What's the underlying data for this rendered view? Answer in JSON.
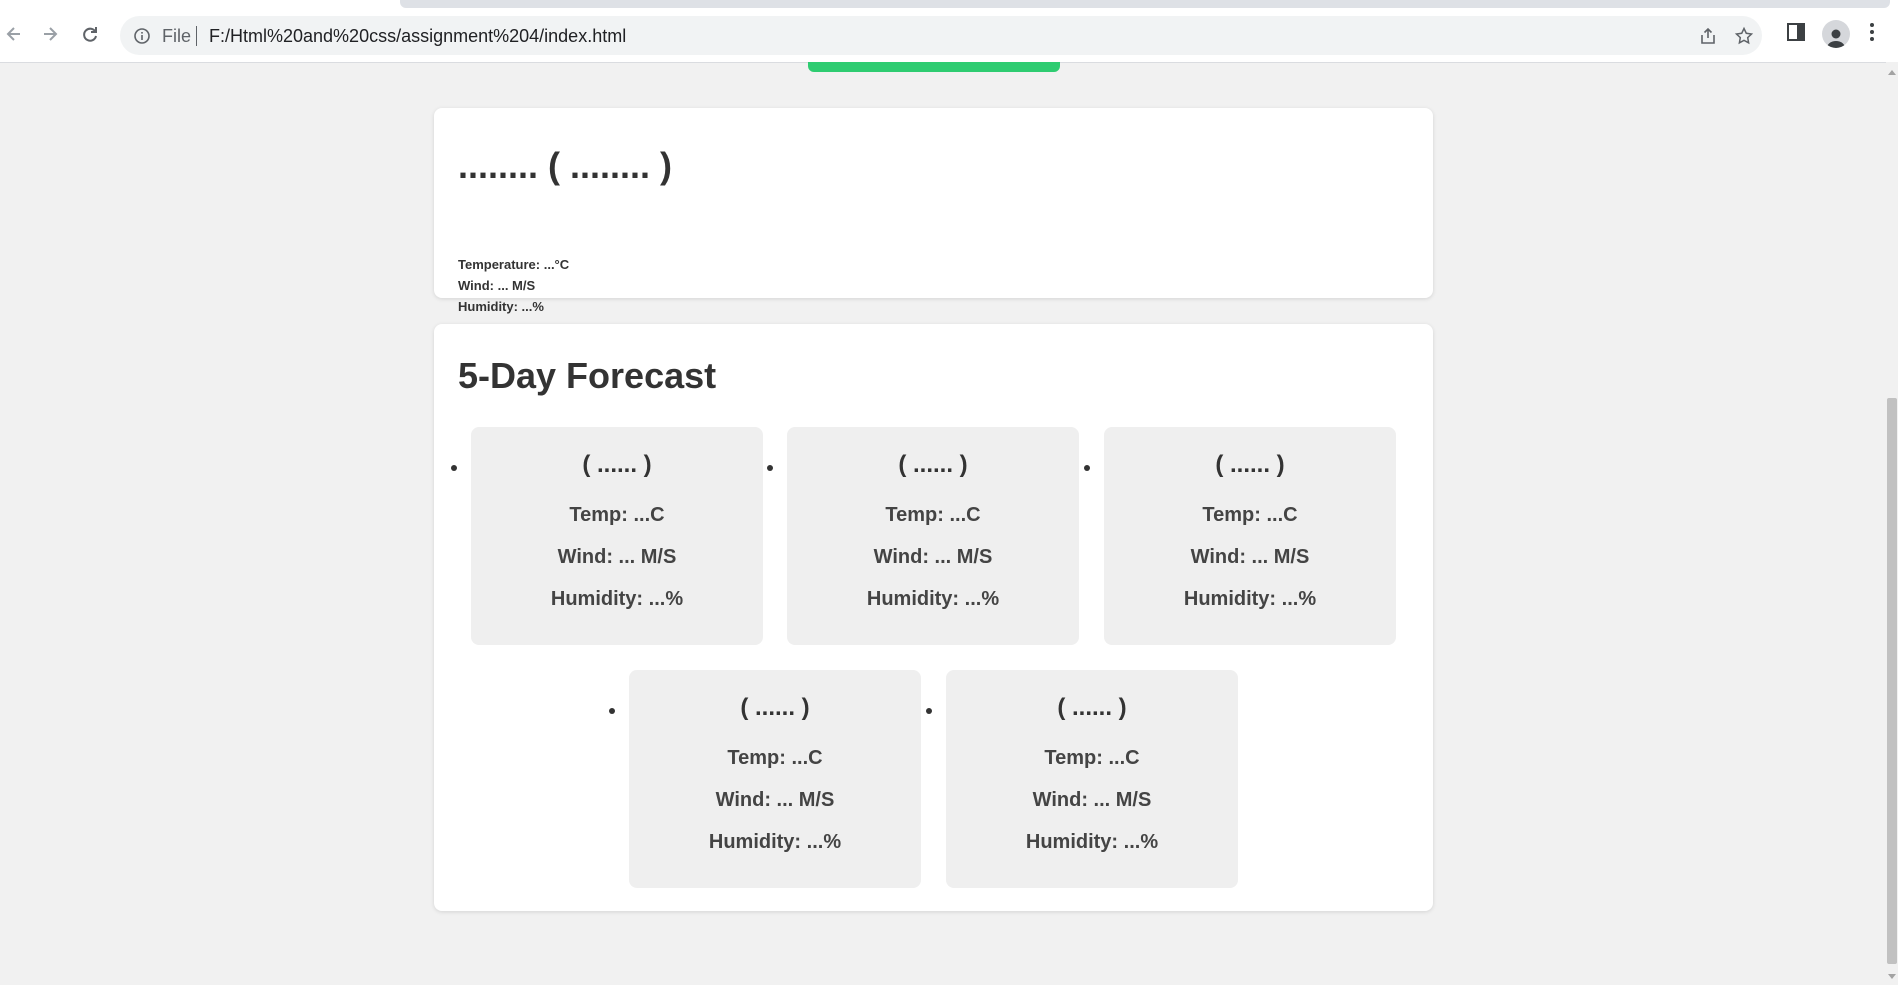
{
  "browser": {
    "scheme_label": "File",
    "url": "F:/Html%20and%20css/assignment%204/index.html",
    "icons": [
      "back-arrow-icon",
      "forward-arrow-icon",
      "reload-icon",
      "info-icon",
      "share-icon",
      "star-icon",
      "side-panel-icon",
      "profile-icon",
      "menu-dots-icon"
    ]
  },
  "current": {
    "title": "........ ( ........ )",
    "temperature": "Temperature: ...°C",
    "wind": "Wind: ... M/S",
    "humidity": "Humidity: ...%"
  },
  "forecast": {
    "title": "5-Day Forecast",
    "days": [
      {
        "date": "( ...... )",
        "temp": "Temp: ...C",
        "wind": "Wind: ... M/S",
        "humidity": "Humidity: ...%"
      },
      {
        "date": "( ...... )",
        "temp": "Temp: ...C",
        "wind": "Wind: ... M/S",
        "humidity": "Humidity: ...%"
      },
      {
        "date": "( ...... )",
        "temp": "Temp: ...C",
        "wind": "Wind: ... M/S",
        "humidity": "Humidity: ...%"
      },
      {
        "date": "( ...... )",
        "temp": "Temp: ...C",
        "wind": "Wind: ... M/S",
        "humidity": "Humidity: ...%"
      },
      {
        "date": "( ...... )",
        "temp": "Temp: ...C",
        "wind": "Wind: ... M/S",
        "humidity": "Humidity: ...%"
      }
    ]
  },
  "colors": {
    "page_bg": "#f1f1f1",
    "card_bg": "#ffffff",
    "day_box_bg": "#efefef",
    "accent_green": "#2ecc71",
    "text": "#333333"
  }
}
